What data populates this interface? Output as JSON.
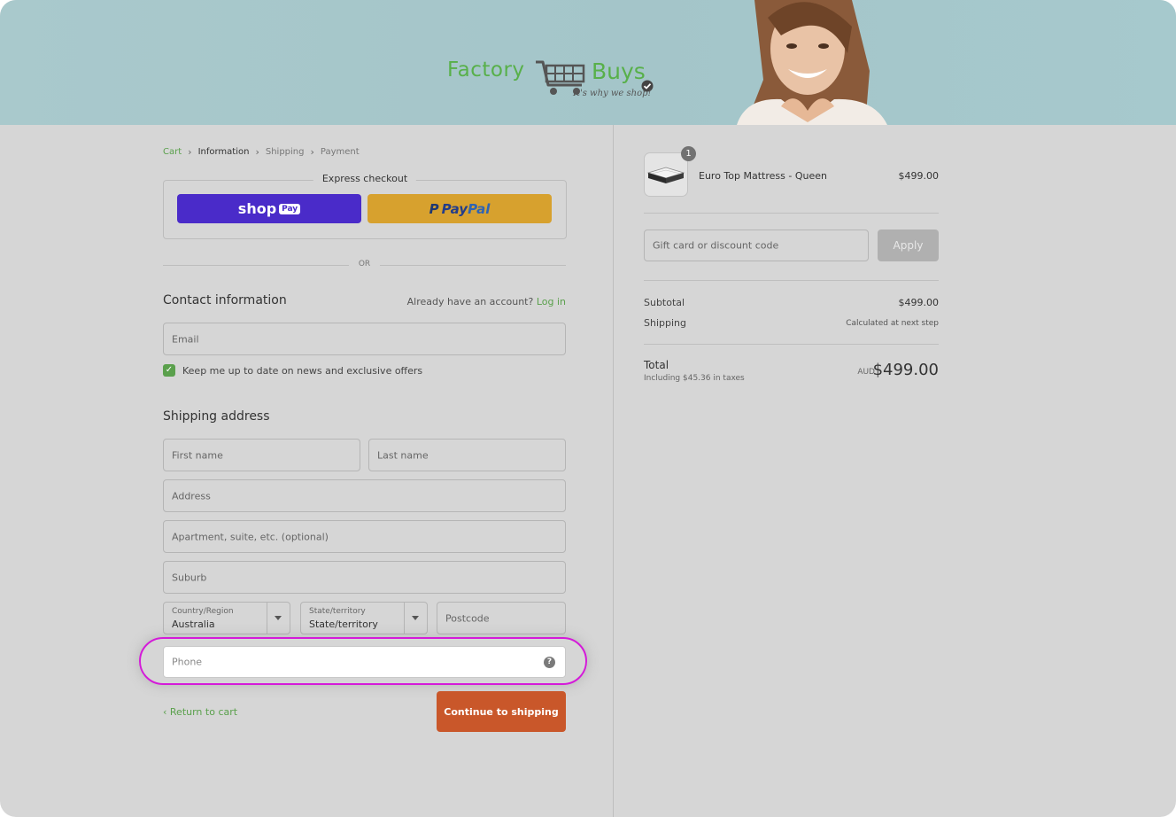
{
  "brand": {
    "logo_word1": "Factory",
    "logo_word2": "Buys",
    "tagline": "It's why we shop!",
    "colors": {
      "brand_green": "#58b04a",
      "shop_pay": "#4a2bc9",
      "paypal_gold": "#d7a12e",
      "continue_orange": "#c9572a",
      "highlight_magenta": "#d41ad9"
    }
  },
  "breadcrumb": {
    "cart": "Cart",
    "information": "Information",
    "shipping": "Shipping",
    "payment": "Payment"
  },
  "express": {
    "legend": "Express checkout",
    "shop_label": "shop",
    "shop_badge": "Pay",
    "paypal_p": "P",
    "paypal_pay": "Pay",
    "paypal_pal": "Pal",
    "or": "OR"
  },
  "contact": {
    "title": "Contact information",
    "account_prompt": "Already have an account?",
    "login": "Log in",
    "email_placeholder": "Email",
    "newsletter_label": "Keep me up to date on news and exclusive offers",
    "newsletter_checked": true
  },
  "shipping": {
    "title": "Shipping address",
    "first_name": "First name",
    "last_name": "Last name",
    "address": "Address",
    "apartment": "Apartment, suite, etc. (optional)",
    "suburb": "Suburb",
    "country_label": "Country/Region",
    "country_value": "Australia",
    "state_label": "State/territory",
    "state_value": "State/territory",
    "postcode": "Postcode",
    "phone": "Phone",
    "help_icon": "?"
  },
  "actions": {
    "return_label": "Return to cart",
    "continue_label": "Continue to shipping"
  },
  "summary": {
    "item_qty": "1",
    "item_name": "Euro Top Mattress - Queen",
    "item_price": "$499.00",
    "discount_placeholder": "Gift card or discount code",
    "apply_label": "Apply",
    "subtotal_label": "Subtotal",
    "subtotal_value": "$499.00",
    "shipping_label": "Shipping",
    "shipping_value": "Calculated at next step",
    "total_label": "Total",
    "tax_note": "Including $45.36 in taxes",
    "currency": "AUD",
    "total_value": "$499.00"
  }
}
